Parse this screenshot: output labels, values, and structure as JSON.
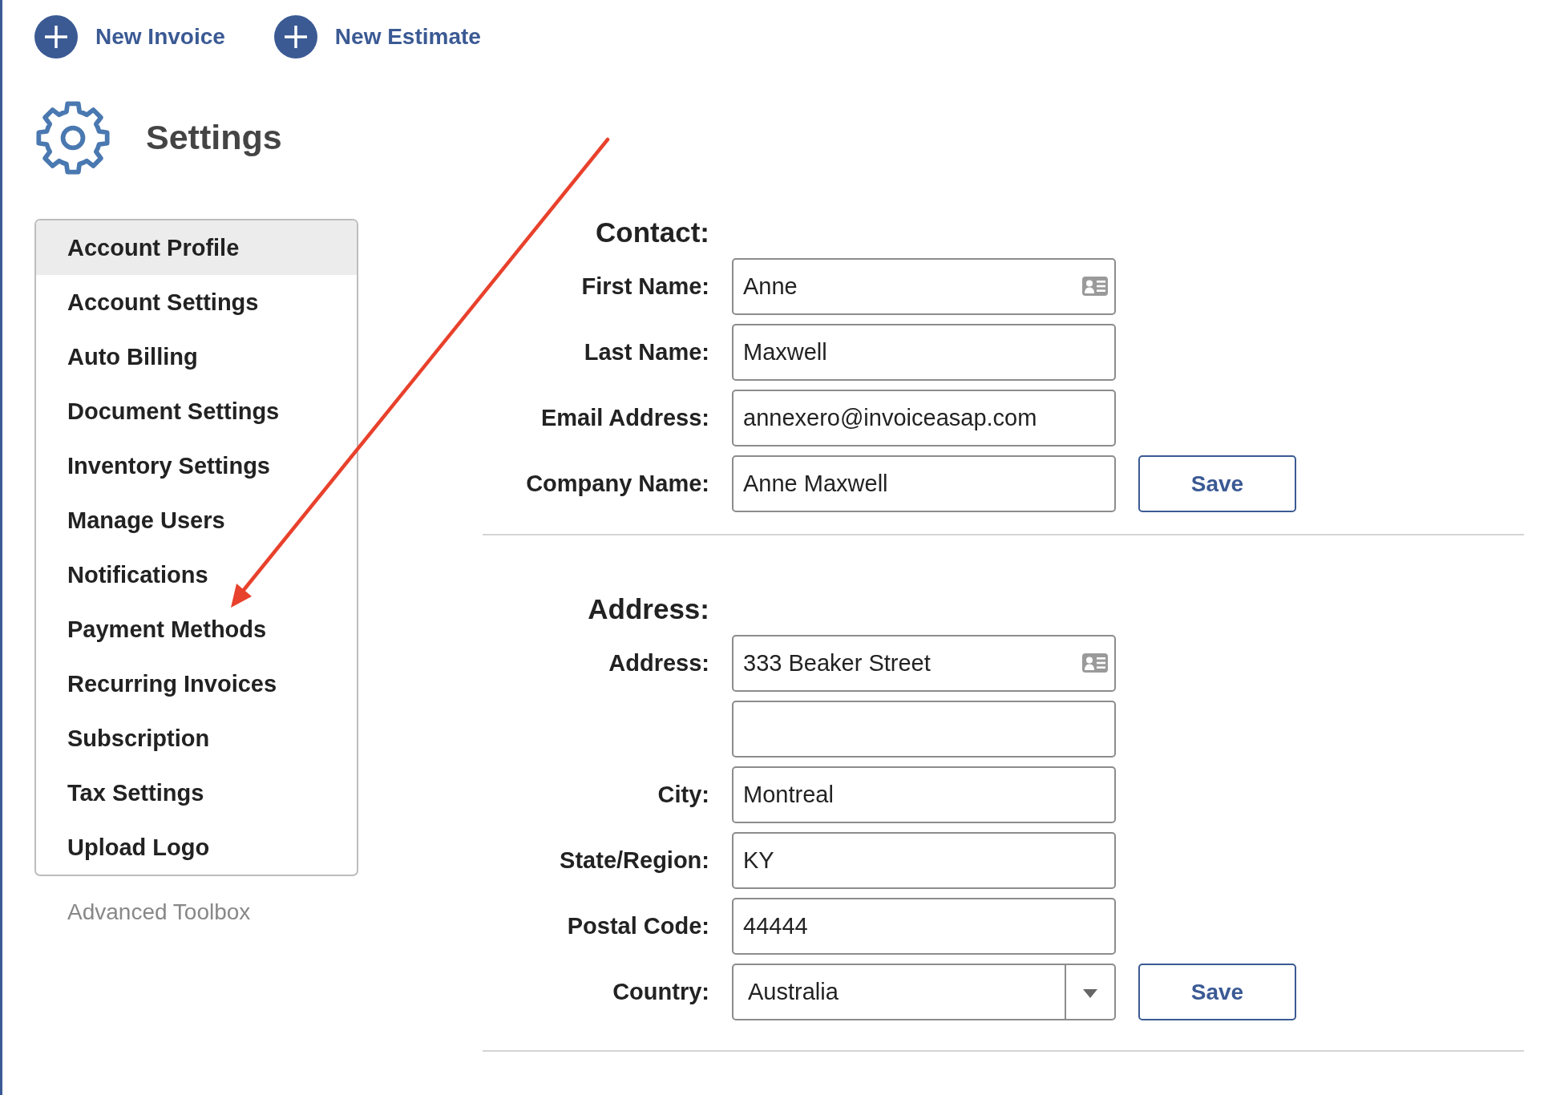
{
  "toolbar": {
    "actions": [
      {
        "label": "New Invoice"
      },
      {
        "label": "New Estimate"
      }
    ]
  },
  "page_title": "Settings",
  "sidebar": {
    "items": [
      {
        "label": "Account Profile",
        "selected": true
      },
      {
        "label": "Account Settings",
        "selected": false
      },
      {
        "label": "Auto Billing",
        "selected": false
      },
      {
        "label": "Document Settings",
        "selected": false
      },
      {
        "label": "Inventory Settings",
        "selected": false
      },
      {
        "label": "Manage Users",
        "selected": false
      },
      {
        "label": "Notifications",
        "selected": false
      },
      {
        "label": "Payment Methods",
        "selected": false
      },
      {
        "label": "Recurring Invoices",
        "selected": false
      },
      {
        "label": "Subscription",
        "selected": false
      },
      {
        "label": "Tax Settings",
        "selected": false
      },
      {
        "label": "Upload Logo",
        "selected": false
      }
    ],
    "footer_link": "Advanced Toolbox"
  },
  "sections": [
    {
      "heading": "Contact:",
      "fields": [
        {
          "label": "First Name:",
          "kind": "lookup",
          "value": "Anne"
        },
        {
          "label": "Last Name:",
          "kind": "text",
          "value": "Maxwell"
        },
        {
          "label": "Email Address:",
          "kind": "text",
          "value": "annexero@invoiceasap.com"
        },
        {
          "label": "Company Name:",
          "kind": "text",
          "value": "Anne Maxwell"
        }
      ],
      "save_button": "Save"
    },
    {
      "heading": "Address:",
      "fields": [
        {
          "label": "Address:",
          "kind": "lookup",
          "value": "333 Beaker Street"
        },
        {
          "kind": "text"
        },
        {
          "label": "City:",
          "kind": "text",
          "value": "Montreal"
        },
        {
          "label": "State/Region:",
          "kind": "text",
          "value": "KY"
        },
        {
          "label": "Postal Code:",
          "kind": "text",
          "value": "44444"
        },
        {
          "label": "Country:",
          "kind": "select",
          "value": "Australia"
        }
      ],
      "save_button": "Save"
    }
  ],
  "annotations": [
    {
      "kind": "arrow"
    }
  ]
}
